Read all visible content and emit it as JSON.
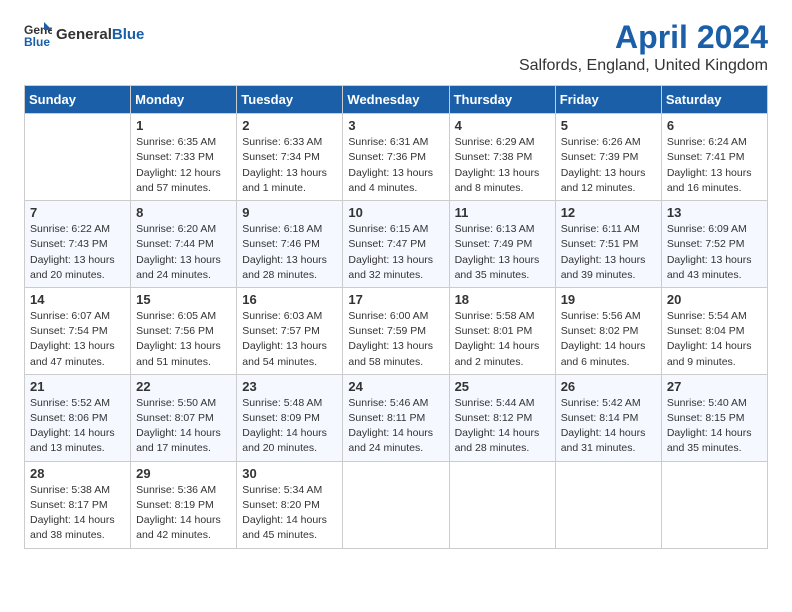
{
  "header": {
    "logo_general": "General",
    "logo_blue": "Blue",
    "month_title": "April 2024",
    "location": "Salfords, England, United Kingdom"
  },
  "weekdays": [
    "Sunday",
    "Monday",
    "Tuesday",
    "Wednesday",
    "Thursday",
    "Friday",
    "Saturday"
  ],
  "weeks": [
    [
      {
        "day": "",
        "content": ""
      },
      {
        "day": "1",
        "content": "Sunrise: 6:35 AM\nSunset: 7:33 PM\nDaylight: 12 hours\nand 57 minutes."
      },
      {
        "day": "2",
        "content": "Sunrise: 6:33 AM\nSunset: 7:34 PM\nDaylight: 13 hours\nand 1 minute."
      },
      {
        "day": "3",
        "content": "Sunrise: 6:31 AM\nSunset: 7:36 PM\nDaylight: 13 hours\nand 4 minutes."
      },
      {
        "day": "4",
        "content": "Sunrise: 6:29 AM\nSunset: 7:38 PM\nDaylight: 13 hours\nand 8 minutes."
      },
      {
        "day": "5",
        "content": "Sunrise: 6:26 AM\nSunset: 7:39 PM\nDaylight: 13 hours\nand 12 minutes."
      },
      {
        "day": "6",
        "content": "Sunrise: 6:24 AM\nSunset: 7:41 PM\nDaylight: 13 hours\nand 16 minutes."
      }
    ],
    [
      {
        "day": "7",
        "content": "Sunrise: 6:22 AM\nSunset: 7:43 PM\nDaylight: 13 hours\nand 20 minutes."
      },
      {
        "day": "8",
        "content": "Sunrise: 6:20 AM\nSunset: 7:44 PM\nDaylight: 13 hours\nand 24 minutes."
      },
      {
        "day": "9",
        "content": "Sunrise: 6:18 AM\nSunset: 7:46 PM\nDaylight: 13 hours\nand 28 minutes."
      },
      {
        "day": "10",
        "content": "Sunrise: 6:15 AM\nSunset: 7:47 PM\nDaylight: 13 hours\nand 32 minutes."
      },
      {
        "day": "11",
        "content": "Sunrise: 6:13 AM\nSunset: 7:49 PM\nDaylight: 13 hours\nand 35 minutes."
      },
      {
        "day": "12",
        "content": "Sunrise: 6:11 AM\nSunset: 7:51 PM\nDaylight: 13 hours\nand 39 minutes."
      },
      {
        "day": "13",
        "content": "Sunrise: 6:09 AM\nSunset: 7:52 PM\nDaylight: 13 hours\nand 43 minutes."
      }
    ],
    [
      {
        "day": "14",
        "content": "Sunrise: 6:07 AM\nSunset: 7:54 PM\nDaylight: 13 hours\nand 47 minutes."
      },
      {
        "day": "15",
        "content": "Sunrise: 6:05 AM\nSunset: 7:56 PM\nDaylight: 13 hours\nand 51 minutes."
      },
      {
        "day": "16",
        "content": "Sunrise: 6:03 AM\nSunset: 7:57 PM\nDaylight: 13 hours\nand 54 minutes."
      },
      {
        "day": "17",
        "content": "Sunrise: 6:00 AM\nSunset: 7:59 PM\nDaylight: 13 hours\nand 58 minutes."
      },
      {
        "day": "18",
        "content": "Sunrise: 5:58 AM\nSunset: 8:01 PM\nDaylight: 14 hours\nand 2 minutes."
      },
      {
        "day": "19",
        "content": "Sunrise: 5:56 AM\nSunset: 8:02 PM\nDaylight: 14 hours\nand 6 minutes."
      },
      {
        "day": "20",
        "content": "Sunrise: 5:54 AM\nSunset: 8:04 PM\nDaylight: 14 hours\nand 9 minutes."
      }
    ],
    [
      {
        "day": "21",
        "content": "Sunrise: 5:52 AM\nSunset: 8:06 PM\nDaylight: 14 hours\nand 13 minutes."
      },
      {
        "day": "22",
        "content": "Sunrise: 5:50 AM\nSunset: 8:07 PM\nDaylight: 14 hours\nand 17 minutes."
      },
      {
        "day": "23",
        "content": "Sunrise: 5:48 AM\nSunset: 8:09 PM\nDaylight: 14 hours\nand 20 minutes."
      },
      {
        "day": "24",
        "content": "Sunrise: 5:46 AM\nSunset: 8:11 PM\nDaylight: 14 hours\nand 24 minutes."
      },
      {
        "day": "25",
        "content": "Sunrise: 5:44 AM\nSunset: 8:12 PM\nDaylight: 14 hours\nand 28 minutes."
      },
      {
        "day": "26",
        "content": "Sunrise: 5:42 AM\nSunset: 8:14 PM\nDaylight: 14 hours\nand 31 minutes."
      },
      {
        "day": "27",
        "content": "Sunrise: 5:40 AM\nSunset: 8:15 PM\nDaylight: 14 hours\nand 35 minutes."
      }
    ],
    [
      {
        "day": "28",
        "content": "Sunrise: 5:38 AM\nSunset: 8:17 PM\nDaylight: 14 hours\nand 38 minutes."
      },
      {
        "day": "29",
        "content": "Sunrise: 5:36 AM\nSunset: 8:19 PM\nDaylight: 14 hours\nand 42 minutes."
      },
      {
        "day": "30",
        "content": "Sunrise: 5:34 AM\nSunset: 8:20 PM\nDaylight: 14 hours\nand 45 minutes."
      },
      {
        "day": "",
        "content": ""
      },
      {
        "day": "",
        "content": ""
      },
      {
        "day": "",
        "content": ""
      },
      {
        "day": "",
        "content": ""
      }
    ]
  ]
}
